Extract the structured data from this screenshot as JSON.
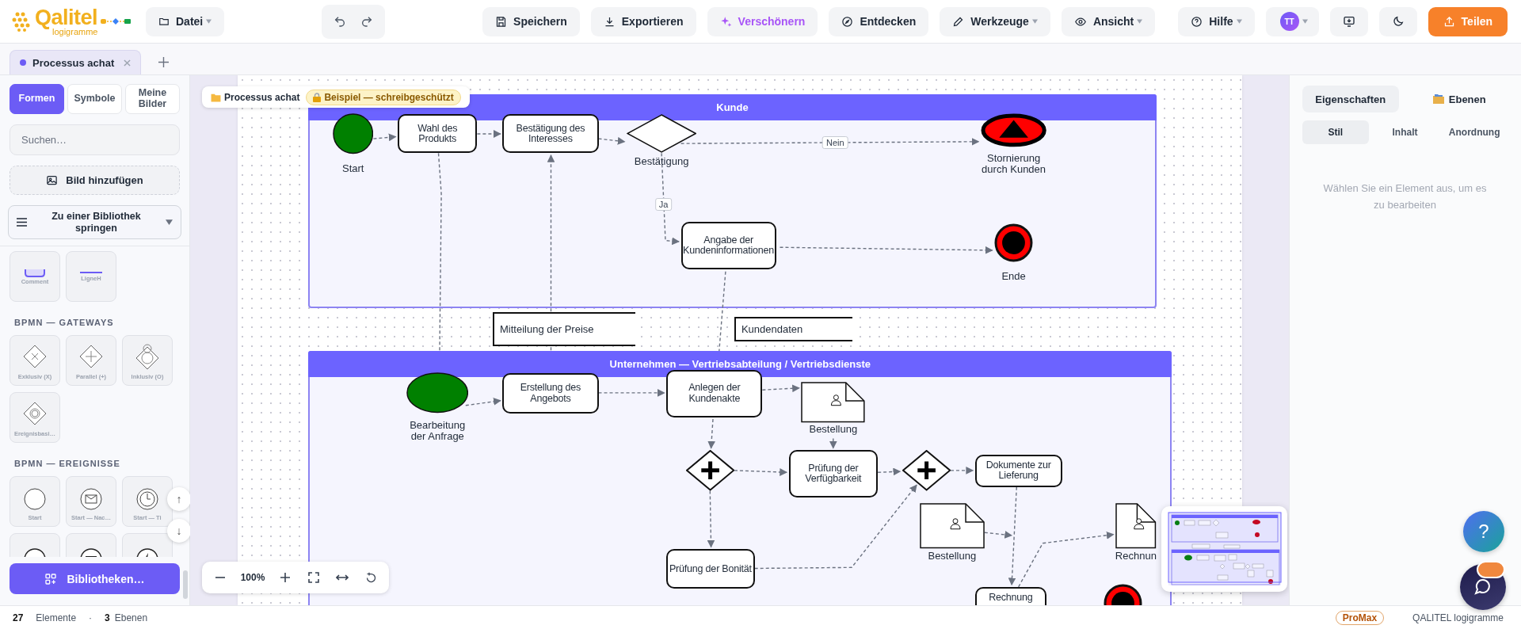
{
  "header": {
    "logo": {
      "name": "Qalitel",
      "subtitle": "logigramme"
    },
    "file_menu": {
      "label": "Datei"
    },
    "actions": [
      {
        "kind": "action",
        "label": "Speichern"
      },
      {
        "kind": "action",
        "label": "Exportieren"
      },
      {
        "kind": "accent",
        "label": "Verschönern"
      },
      {
        "kind": "action",
        "label": "Entdecken"
      },
      {
        "kind": "menu",
        "label": "Werkzeuge"
      },
      {
        "kind": "menu",
        "label": "Ansicht"
      }
    ],
    "help": {
      "label": "Hilfe"
    },
    "avatar": {
      "initials": "TT"
    },
    "share": {
      "label": "Teilen"
    }
  },
  "document_tabs": [
    {
      "label": "Processus achat",
      "selected": true
    }
  ],
  "sidebar": {
    "tabs": [
      {
        "label": "Formen",
        "selected": true
      },
      {
        "label": "Symbole",
        "selected": false
      },
      {
        "label": "Meine Bilder",
        "selected": false
      }
    ],
    "search": {
      "placeholder": "Suchen…"
    },
    "add_image": "Bild hinzufügen",
    "library_jump": "Zu einer Bibliothek springen",
    "sections": [
      {
        "items": [
          {
            "kind": "comment",
            "label": "Comment"
          },
          {
            "kind": "line",
            "label": "LigneH"
          }
        ]
      },
      {
        "title": "BPMN — GATEWAYS",
        "items": [
          {
            "kind": "exclusive",
            "label": "Exklusiv (X)"
          },
          {
            "kind": "parallel",
            "label": "Parallel (+)"
          },
          {
            "kind": "inclusive",
            "label": "Inklusiv (O)"
          },
          {
            "kind": "event-based",
            "label": "Ereignisbasi…"
          }
        ]
      },
      {
        "title": "BPMN — EREIGNISSE",
        "items": [
          {
            "kind": "start",
            "label": "Start"
          },
          {
            "kind": "start-message",
            "label": "Start — Nac…"
          },
          {
            "kind": "start-timer",
            "label": "Start — Ti"
          },
          {
            "kind": "intermediate"
          },
          {
            "kind": "intermediate-message"
          },
          {
            "kind": "intermediate-signal"
          }
        ]
      }
    ],
    "scroll_buttons": [
      "↑",
      "↓"
    ],
    "libraries_button": "Bibliotheken…"
  },
  "canvas": {
    "breadcrumb": "Processus achat",
    "badge": "Beispiel — schreibgeschützt",
    "lanes": [
      {
        "title": "Kunde"
      },
      {
        "title": "Unternehmen — Vertriebsabteilung / Vertriebsdienste"
      }
    ],
    "nodes": [
      {
        "kind": "start",
        "label": "Start"
      },
      {
        "kind": "task",
        "label": "Wahl des Produkts"
      },
      {
        "kind": "task",
        "label": "Bestätigung des Interesses"
      },
      {
        "kind": "exclusive-gateway",
        "label": "Bestätigung"
      },
      {
        "kind": "cancel-end",
        "label": "Stornierung durch Kunden"
      },
      {
        "kind": "task",
        "label": "Angabe der Kundeninformationen"
      },
      {
        "kind": "end",
        "label": "Ende"
      },
      {
        "kind": "data",
        "label": "Mitteilung der Preise"
      },
      {
        "kind": "data",
        "label": "Kundendaten"
      },
      {
        "kind": "start",
        "label": "Bearbeitung der Anfrage"
      },
      {
        "kind": "task",
        "label": "Erstellung des Angebots"
      },
      {
        "kind": "task",
        "label": "Anlegen der Kundenakte"
      },
      {
        "kind": "document",
        "label": "Bestellung"
      },
      {
        "kind": "parallel-gateway"
      },
      {
        "kind": "task",
        "label": "Prüfung der Verfügbarkeit"
      },
      {
        "kind": "parallel-gateway"
      },
      {
        "kind": "task",
        "label": "Dokumente zur Lieferung"
      },
      {
        "kind": "document",
        "label": "Bestellung"
      },
      {
        "kind": "task",
        "label": "Prüfung der Bonität"
      },
      {
        "kind": "document",
        "label": "Rechnun"
      },
      {
        "kind": "task",
        "label": "Rechnung"
      },
      {
        "kind": "end"
      }
    ],
    "edge_labels": [
      "Nein",
      "Ja"
    ],
    "zoom_level": "100%"
  },
  "properties_panel": {
    "tabs": [
      {
        "label": "Eigenschaften",
        "selected": true
      },
      {
        "label": "Ebenen",
        "selected": false
      }
    ],
    "subtabs": [
      {
        "label": "Stil",
        "selected": true
      },
      {
        "label": "Inhalt",
        "selected": false
      },
      {
        "label": "Anordnung",
        "selected": false
      }
    ],
    "hint": "Wählen Sie ein Element aus, um es zu bearbeiten"
  },
  "help_button": "?",
  "status_bar": {
    "element_count": "27",
    "element_label": "Elemente",
    "separator": "·",
    "layer_count": "3",
    "layer_label": "Ebenen",
    "plan": "ProMax",
    "product": "QALITEL logigramme"
  }
}
